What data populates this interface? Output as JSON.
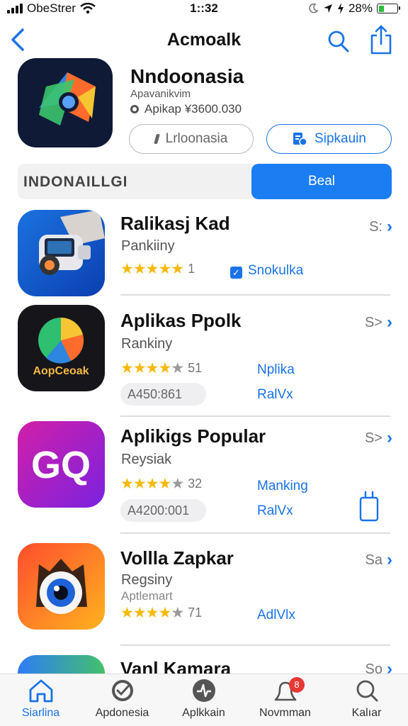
{
  "status_bar": {
    "carrier": "ObeStrer",
    "time": "1::32",
    "battery": "28%",
    "battery_level": 0.28
  },
  "nav": {
    "title": "Acmoalk"
  },
  "header": {
    "app_name": "Nndoonasia",
    "subtitle": "Apavanikvim",
    "meta": "Apikap  ¥3600.030",
    "button_left": "Lrloonasia",
    "button_right": "Sipkauin"
  },
  "segmented": {
    "left": "INDONAILLGI",
    "right": "Beal"
  },
  "apps": [
    {
      "name": "Ralikasj Kad",
      "category": "Pankiiny",
      "stars": 5,
      "rating_count": "1",
      "tag": "Snokulka",
      "more": "S:"
    },
    {
      "name": "Aplikas Ppolk",
      "category": "Rankiny",
      "stars": 4,
      "rating_count": "51",
      "tag": "Nplika",
      "tag2": "RalVx",
      "price": "A450:861",
      "icon_text": "AopCeoak",
      "more": "S>"
    },
    {
      "name": "Aplikigs Popular",
      "category": "Reysiak",
      "stars": 4,
      "rating_count": "32",
      "tag": "Manking",
      "tag2": "RalVx",
      "price": "A4200:001",
      "icon_text": "GQ",
      "more": "S>"
    },
    {
      "name": "Vollla Zapkar",
      "category": "Regsiny",
      "category2": "Aptlemart",
      "stars": 4,
      "rating_count": "71",
      "tag": "AdlVlx",
      "more": "Sa"
    },
    {
      "name": "Vanl Kamara",
      "more": "So"
    }
  ],
  "tabs": [
    {
      "label": "Siarlina",
      "icon": "home-icon",
      "active": true
    },
    {
      "label": "Apdonesia",
      "icon": "check-badge-icon"
    },
    {
      "label": "Aplkkain",
      "icon": "activity-icon"
    },
    {
      "label": "Novmman",
      "icon": "bell-icon",
      "badge": "8"
    },
    {
      "label": "Kalıar",
      "icon": "search-icon"
    }
  ],
  "colors": {
    "accent": "#1a73e8",
    "star": "#f5b90a",
    "badge": "#e53935"
  }
}
